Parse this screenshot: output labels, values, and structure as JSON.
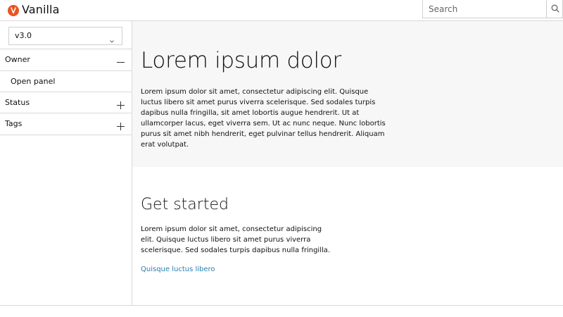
{
  "header": {
    "brand": "Vanilla",
    "search_placeholder": "Search",
    "accent": "#e95420"
  },
  "sidebar": {
    "version_select": {
      "value": "v3.0"
    },
    "sections": [
      {
        "label": "Owner",
        "expanded": true,
        "items": [
          {
            "label": "Open panel"
          }
        ]
      },
      {
        "label": "Status",
        "expanded": false
      },
      {
        "label": "Tags",
        "expanded": false
      }
    ]
  },
  "hero": {
    "title": "Lorem ipsum dolor",
    "body": "Lorem ipsum dolor sit amet, consectetur adipiscing elit. Quisque luctus libero sit amet purus viverra scelerisque. Sed sodales turpis dapibus nulla fringilla, sit amet lobortis augue hendrerit. Ut at ullamcorper lacus, eget viverra sem. Ut ac nunc neque. Nunc lobortis purus sit amet nibh hendrerit, eget pulvinar tellus hendrerit. Aliquam erat volutpat."
  },
  "get_started": {
    "title": "Get started",
    "body": "Lorem ipsum dolor sit amet, consectetur adipiscing elit. Quisque luctus libero sit amet purus viverra scelerisque. Sed sodales turpis dapibus nulla fringilla.",
    "link": "Quisque luctus libero",
    "link_color": "#2a7fae"
  },
  "icons": {
    "logo": "vanilla-logo-icon",
    "search": "search-icon",
    "select": "chevron-down-icon",
    "collapse": "minus-icon",
    "expand": "plus-icon"
  }
}
